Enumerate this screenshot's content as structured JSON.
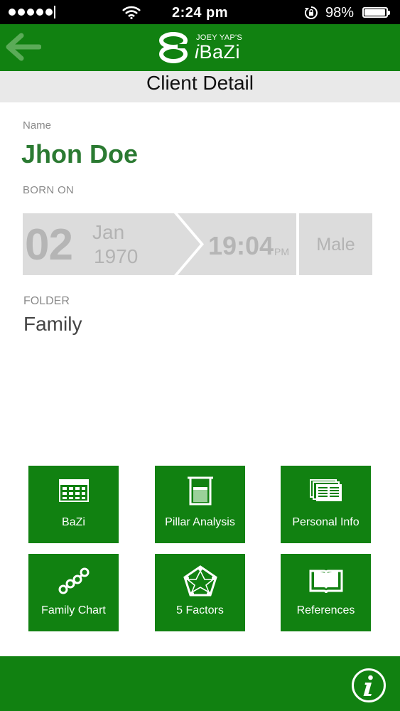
{
  "status_bar": {
    "time": "2:24 pm",
    "battery_percent": "98%",
    "signal_bars": 5,
    "icons": [
      "wifi-icon",
      "rotation-lock-icon",
      "battery-icon"
    ]
  },
  "nav_bar": {
    "back_icon": "arrow-left-icon",
    "logo": {
      "small_text": "JOEY YAP'S",
      "brand_prefix": "i",
      "brand_name": "BaZi"
    },
    "color": "#118111"
  },
  "page": {
    "title": "Client Detail"
  },
  "client": {
    "name_label": "Name",
    "name": "Jhon Doe",
    "born_label": "BORN ON",
    "birth": {
      "day": "02",
      "month": "Jan",
      "year": "1970",
      "time": "19:04",
      "ampm": "PM"
    },
    "gender": "Male",
    "folder_label": "FOLDER",
    "folder": "Family"
  },
  "menu_tiles": [
    {
      "label": "BaZi",
      "icon": "calendar-grid-icon"
    },
    {
      "label": "Pillar Analysis",
      "icon": "beaker-icon"
    },
    {
      "label": "Personal Info",
      "icon": "documents-icon"
    },
    {
      "label": "Family Chart",
      "icon": "connected-nodes-icon"
    },
    {
      "label": "5 Factors",
      "icon": "pentagon-star-icon"
    },
    {
      "label": "References",
      "icon": "open-book-icon"
    }
  ],
  "bottom_bar": {
    "info_icon": "info-icon"
  },
  "colors": {
    "accent_green": "#118111",
    "name_green": "#2b7a32",
    "panel_gray": "#dcdcdc"
  }
}
